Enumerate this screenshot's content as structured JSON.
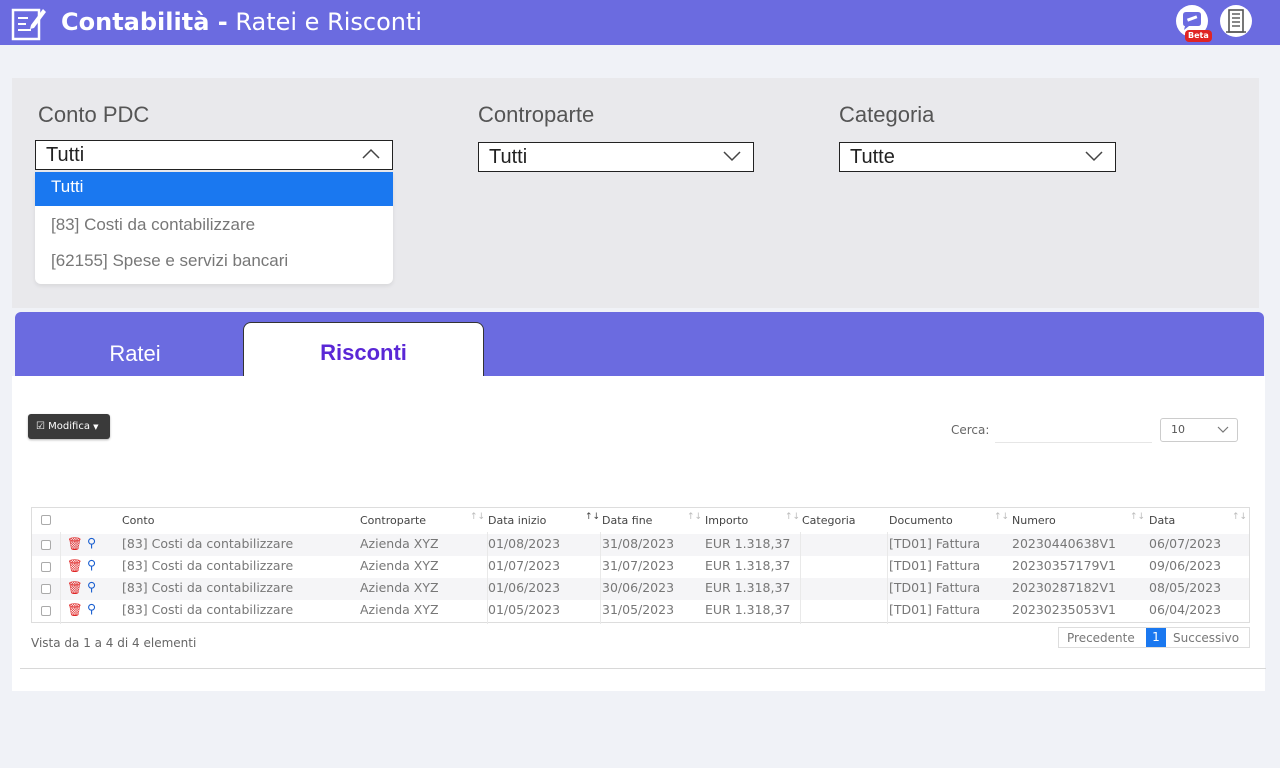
{
  "header": {
    "title_bold": "Contabilità -",
    "title_rest": "Ratei e Risconti",
    "beta_badge": "Beta",
    "bg_color": "#6b6be0"
  },
  "filters": {
    "conto": {
      "label": "Conto PDC",
      "value": "Tutti",
      "options": [
        "Tutti",
        "[83] Costi da contabilizzare",
        "[62155] Spese e servizi bancari"
      ]
    },
    "controparte": {
      "label": "Controparte",
      "value": "Tutti"
    },
    "categoria": {
      "label": "Categoria",
      "value": "Tutte"
    }
  },
  "tabs": [
    {
      "label": "Ratei",
      "active": false
    },
    {
      "label": "Risconti",
      "active": true
    }
  ],
  "toolbar": {
    "modifica_label": "Modifica",
    "search_label": "Cerca:",
    "page_size": "10"
  },
  "table": {
    "columns": [
      "Conto",
      "Controparte",
      "Data inizio",
      "Data fine",
      "Importo",
      "Categoria",
      "Documento",
      "Numero",
      "Data"
    ],
    "rows": [
      [
        "[83] Costi da contabilizzare",
        "Azienda XYZ",
        "01/08/2023",
        "31/08/2023",
        "EUR 1.318,37",
        "",
        "[TD01] Fattura",
        "20230440638V1",
        "06/07/2023"
      ],
      [
        "[83] Costi da contabilizzare",
        "Azienda XYZ",
        "01/07/2023",
        "31/07/2023",
        "EUR 1.318,37",
        "",
        "[TD01] Fattura",
        "20230357179V1",
        "09/06/2023"
      ],
      [
        "[83] Costi da contabilizzare",
        "Azienda XYZ",
        "01/06/2023",
        "30/06/2023",
        "EUR 1.318,37",
        "",
        "[TD01] Fattura",
        "20230287182V1",
        "08/05/2023"
      ],
      [
        "[83] Costi da contabilizzare",
        "Azienda XYZ",
        "01/05/2023",
        "31/05/2023",
        "EUR 1.318,37",
        "",
        "[TD01] Fattura",
        "20230235053V1",
        "06/04/2023"
      ]
    ]
  },
  "footer": {
    "info": "Vista da 1 a 4 di 4 elementi",
    "prev": "Precedente",
    "page": "1",
    "next": "Successivo"
  }
}
